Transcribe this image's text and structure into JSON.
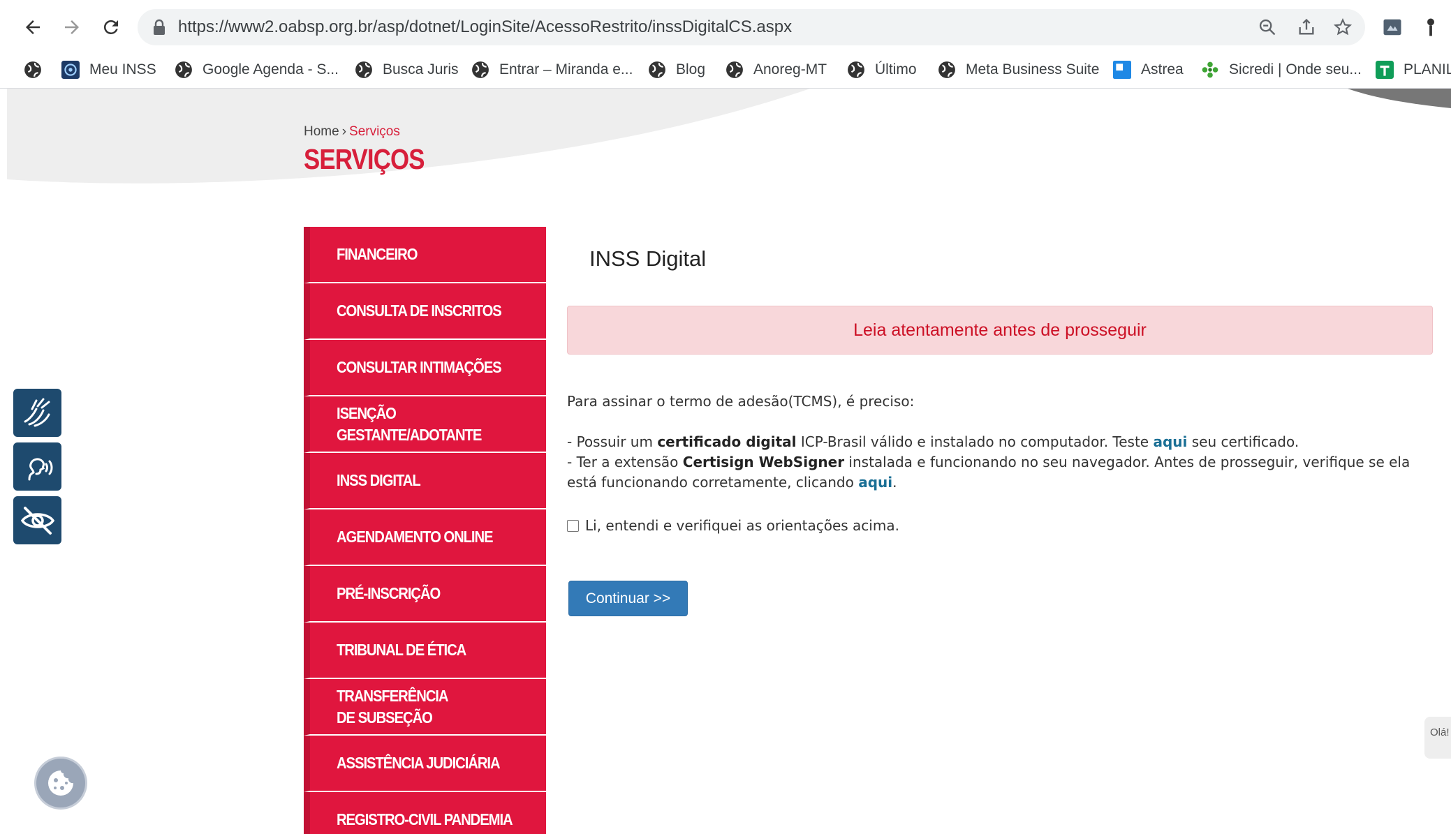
{
  "browser": {
    "url": "https://www2.oabsp.org.br/asp/dotnet/LoginSite/AcessoRestrito/inssDigitalCS.aspx",
    "bookmarks": [
      {
        "label": ""
      },
      {
        "label": "Meu INSS"
      },
      {
        "label": "Google Agenda - S..."
      },
      {
        "label": "Busca Juris"
      },
      {
        "label": "Entrar – Miranda e..."
      },
      {
        "label": "Blog"
      },
      {
        "label": "Anoreg-MT"
      },
      {
        "label": "Último"
      },
      {
        "label": "Meta Business Suite"
      },
      {
        "label": "Astrea"
      },
      {
        "label": "Sicredi | Onde seu..."
      },
      {
        "label": "PLANIL"
      }
    ]
  },
  "breadcrumb": {
    "home": "Home",
    "separator": "›",
    "current": "Serviços"
  },
  "page_title": "SERVIÇOS",
  "menu": [
    {
      "label": "Financeiro"
    },
    {
      "label": "Consulta de Inscritos"
    },
    {
      "label": "Consultar Intimações"
    },
    {
      "label": "Isenção Gestante/Adotante"
    },
    {
      "label": "INSS Digital"
    },
    {
      "label": "Agendamento Online"
    },
    {
      "label": "Pré-Inscrição"
    },
    {
      "label": "Tribunal de Ética"
    },
    {
      "label": "Transferência de Subseção"
    },
    {
      "label": "Assistência Judiciária"
    },
    {
      "label": "Registro-Civil Pandemia"
    }
  ],
  "content": {
    "title": "INSS Digital",
    "alert": "Leia atentamente antes de prosseguir",
    "intro": "Para assinar o termo de adesão(TCMS), é preciso:",
    "line1": {
      "prefix": "- Possuir um ",
      "bold": "certificado digital",
      "middle": " ICP-Brasil válido e instalado no computador. Teste ",
      "link": "aqui",
      "suffix": " seu certificado."
    },
    "line2": {
      "prefix": "- Ter a extensão ",
      "bold": "Certisign WebSigner",
      "middle": " instalada e funcionando no seu navegador. Antes de prosseguir, verifique se ela está funcionando corretamente, clicando ",
      "link": "aqui",
      "suffix": "."
    },
    "checkbox_label": "Li, entendi e verifiquei as orientações acima.",
    "checkbox_checked": false,
    "button": "Continuar >>"
  },
  "chat_label": "Olá!",
  "colors": {
    "brand_red": "#e0163e",
    "alert_bg": "#f8d7da",
    "button_blue": "#337ab7",
    "link_blue": "#1a6f95",
    "a11y_bg": "#1e4a6e"
  },
  "icons": [
    "back-arrow-icon",
    "forward-arrow-icon",
    "reload-icon",
    "lock-icon",
    "zoom-icon",
    "share-icon",
    "star-icon",
    "extension-icon",
    "pin-icon",
    "sign-language-icon",
    "voice-reader-icon",
    "low-vision-icon",
    "cookie-icon"
  ]
}
